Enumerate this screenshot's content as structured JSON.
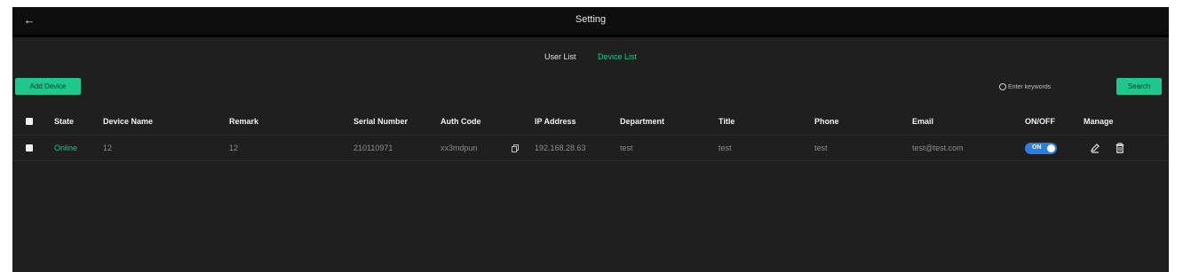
{
  "header": {
    "back_icon": "back-arrow-icon",
    "title": "Setting"
  },
  "tabs": [
    {
      "label": "User List",
      "active": false
    },
    {
      "label": "Device List",
      "active": true
    }
  ],
  "toolbar": {
    "add_label": "Add Device",
    "search_placeholder": "Enter keywords",
    "search_label": "Search"
  },
  "table": {
    "columns": [
      "State",
      "Device Name",
      "Remark",
      "Serial Number",
      "Auth Code",
      "IP Address",
      "Department",
      "Title",
      "Phone",
      "Email",
      "ON/OFF",
      "Manage"
    ],
    "rows": [
      {
        "state": "Online",
        "device_name": "12",
        "remark": "12",
        "serial_number": "210110971",
        "auth_code": "xx3mdpun",
        "ip_address": "192.168.28.63",
        "department": "test",
        "title": "test",
        "phone": "test",
        "email": "test@test.com",
        "toggle_label": "ON",
        "toggle_on": true
      }
    ]
  },
  "colors": {
    "accent": "#1ec78b",
    "toggle": "#2f7de1",
    "background": "#1f1f1f",
    "topbar": "#0e0e0e"
  },
  "icons": {
    "copy": "copy-icon",
    "edit": "edit-icon",
    "delete": "trash-icon",
    "search": "search-icon"
  }
}
